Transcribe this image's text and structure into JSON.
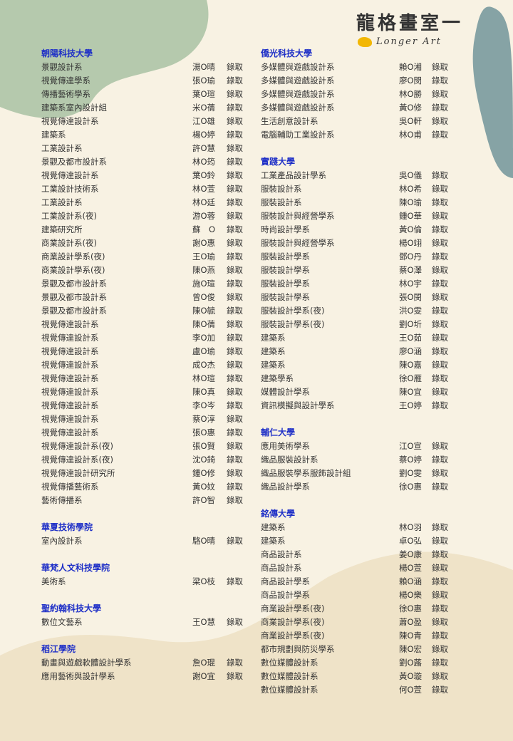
{
  "logo": {
    "chinese": "龍格畫室一",
    "english": "Longer Art"
  },
  "columns": [
    {
      "sections": [
        {
          "school": "朝陽科技大學",
          "rows": [
            [
              "景觀設計系",
              "湯O晴",
              "錄取"
            ],
            [
              "視覺傳達學系",
              "張O瑜",
              "錄取"
            ],
            [
              "傳播藝術學系",
              "葉O瑄",
              "錄取"
            ],
            [
              "建築系室內設計組",
              "米O蒨",
              "錄取"
            ],
            [
              "視覺傳達設計系",
              "江O雄",
              "錄取"
            ],
            [
              "建築系",
              "楊O婷",
              "錄取"
            ],
            [
              "工業設計系",
              "許O慧",
              "錄取"
            ],
            [
              "景觀及都市設計系",
              "林O筠",
              "錄取"
            ],
            [
              "視覺傳達設計系",
              "葉O鈴",
              "錄取"
            ],
            [
              "工業設計技術系",
              "林O萱",
              "錄取"
            ],
            [
              "工業設計系",
              "林O廷",
              "錄取"
            ],
            [
              "工業設計系(夜)",
              "游O蓉",
              "錄取"
            ],
            [
              "建築研究所",
              "蘇　O",
              "錄取"
            ],
            [
              "商業設計系(夜)",
              "謝O惠",
              "錄取"
            ],
            [
              "商業設計學系(夜)",
              "王O瑜",
              "錄取"
            ],
            [
              "商業設計學系(夜)",
              "陳O燕",
              "錄取"
            ],
            [
              "景觀及都市設計系",
              "施O瑄",
              "錄取"
            ],
            [
              "景觀及都市設計系",
              "曾O俊",
              "錄取"
            ],
            [
              "景觀及都市設計系",
              "陳O毓",
              "錄取"
            ],
            [
              "視覺傳達設計系",
              "陳O蒨",
              "錄取"
            ],
            [
              "視覺傳達設計系",
              "李O加",
              "錄取"
            ],
            [
              "視覺傳達設計系",
              "盧O瑜",
              "錄取"
            ],
            [
              "視覺傳達設計系",
              "成O杰",
              "錄取"
            ],
            [
              "視覺傳達設計系",
              "林O瑄",
              "錄取"
            ],
            [
              "視覺傳達設計系",
              "陳O真",
              "錄取"
            ],
            [
              "視覺傳達設計系",
              "李O岑",
              "錄取"
            ],
            [
              "視覺傳達設計系",
              "蔡O淳",
              "錄取"
            ],
            [
              "視覺傳達設計系",
              "張O惠",
              "錄取"
            ],
            [
              "視覺傳達設計系(夜)",
              "張O賢",
              "錄取"
            ],
            [
              "視覺傳達設計系(夜)",
              "沈O錡",
              "錄取"
            ],
            [
              "視覺傳達設計研究所",
              "鍾O修",
              "錄取"
            ],
            [
              "視覺傳播藝術系",
              "黃O妏",
              "錄取"
            ],
            [
              "藝術傳播系",
              "許O智",
              "錄取"
            ]
          ]
        },
        {
          "school": "華夏技術學院",
          "rows": [
            [
              "室內設計系",
              "駱O晴",
              "錄取"
            ]
          ]
        },
        {
          "school": "華梵人文科技學院",
          "rows": [
            [
              "美術系",
              "梁O枝",
              "錄取"
            ]
          ]
        },
        {
          "school": "聖約翰科技大學",
          "rows": [
            [
              "數位文藝系",
              "王O慧",
              "錄取"
            ]
          ]
        },
        {
          "school": "稻江學院",
          "rows": [
            [
              "動畫與遊戲軟體設計學系",
              "詹O琨",
              "錄取"
            ],
            [
              "應用藝術與設計學系",
              "謝O宜",
              "錄取"
            ]
          ]
        }
      ]
    },
    {
      "sections": [
        {
          "school": "僑光科技大學",
          "rows": [
            [
              "多媒體與遊戲設計系",
              "賴O湘",
              "錄取"
            ],
            [
              "多媒體與遊戲設計系",
              "廖O閔",
              "錄取"
            ],
            [
              "多媒體與遊戲設計系",
              "林O勝",
              "錄取"
            ],
            [
              "多媒體與遊戲設計系",
              "黃O修",
              "錄取"
            ],
            [
              "生活創意設計系",
              "吳O軒",
              "錄取"
            ],
            [
              "電腦輔助工業設計系",
              "林O甫",
              "錄取"
            ]
          ]
        },
        {
          "school": "實踐大學",
          "rows": [
            [
              "工業產品設計學系",
              "吳O儀",
              "錄取"
            ],
            [
              "服裝設計系",
              "林O希",
              "錄取"
            ],
            [
              "服裝設計系",
              "陳O瑜",
              "錄取"
            ],
            [
              "服裝設計與經營學系",
              "鍾O華",
              "錄取"
            ],
            [
              "時尚設計學系",
              "黃O倫",
              "錄取"
            ],
            [
              "服裝設計與經營學系",
              "楊O翊",
              "錄取"
            ],
            [
              "服裝設計學系",
              "鄧O丹",
              "錄取"
            ],
            [
              "服裝設計學系",
              "蔡O澤",
              "錄取"
            ],
            [
              "服裝設計學系",
              "林O宇",
              "錄取"
            ],
            [
              "服裝設計學系",
              "張O閔",
              "錄取"
            ],
            [
              "服裝設計學系(夜)",
              "洪O雯",
              "錄取"
            ],
            [
              "服裝設計學系(夜)",
              "劉O圻",
              "錄取"
            ],
            [
              "建築系",
              "王O茹",
              "錄取"
            ],
            [
              "建築系",
              "廖O涵",
              "錄取"
            ],
            [
              "建築系",
              "陳O嘉",
              "錄取"
            ],
            [
              "建築學系",
              "徐O雁",
              "錄取"
            ],
            [
              "媒體設計學系",
              "陳O宜",
              "錄取"
            ],
            [
              "資訊模擬與設計學系",
              "王O婷",
              "錄取"
            ]
          ]
        },
        {
          "school": "輔仁大學",
          "rows": [
            [
              "應用美術學系",
              "江O宣",
              "錄取"
            ],
            [
              "織品服裝設計系",
              "蔡O婷",
              "錄取"
            ],
            [
              "織品服裝學系服飾設計組",
              "劉O雯",
              "錄取"
            ],
            [
              "織品設計學系",
              "徐O惠",
              "錄取"
            ]
          ]
        },
        {
          "school": "銘傳大學",
          "rows": [
            [
              "建築系",
              "林O羽",
              "錄取"
            ],
            [
              "建築系",
              "卓O弘",
              "錄取"
            ],
            [
              "商品設計系",
              "姜O康",
              "錄取"
            ],
            [
              "商品設計系",
              "楊O萱",
              "錄取"
            ],
            [
              "商品設計學系",
              "賴O涵",
              "錄取"
            ],
            [
              "商品設計學系",
              "楊O樂",
              "錄取"
            ],
            [
              "商業設計學系(夜)",
              "徐O惠",
              "錄取"
            ],
            [
              "商業設計學系(夜)",
              "蕭O盈",
              "錄取"
            ],
            [
              "商業設計學系(夜)",
              "陳O青",
              "錄取"
            ],
            [
              "都市規劃與防災學系",
              "陳O宏",
              "錄取"
            ],
            [
              "數位媒體設計系",
              "劉O蕗",
              "錄取"
            ],
            [
              "數位媒體設計系",
              "黃O璇",
              "錄取"
            ],
            [
              "數位媒體設計系",
              "何O萱",
              "錄取"
            ]
          ]
        }
      ]
    }
  ]
}
